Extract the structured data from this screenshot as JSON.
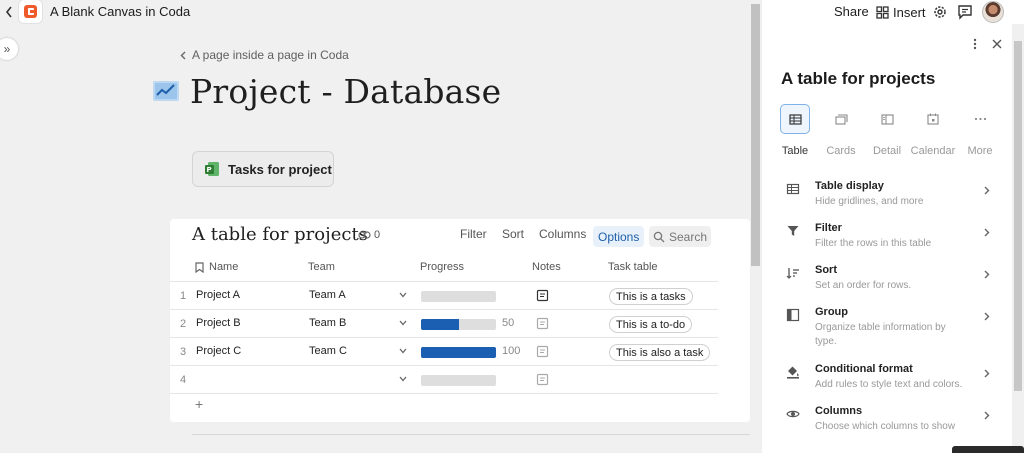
{
  "topbar": {
    "doc_title": "A Blank Canvas in Coda",
    "share_label": "Share",
    "insert_label": "Insert"
  },
  "page": {
    "breadcrumb": "A page inside a page in Coda",
    "title": "Project - Database",
    "button_label": "Tasks for project"
  },
  "table": {
    "title": "A table for projects",
    "link_count": "0",
    "toolbar": {
      "filter": "Filter",
      "sort": "Sort",
      "columns": "Columns",
      "options": "Options",
      "search": "Search"
    },
    "columns": [
      "Name",
      "Team",
      "Progress",
      "Notes",
      "Task table"
    ],
    "rows": [
      {
        "num": "1",
        "name": "Project A",
        "team": "Team A",
        "progress": 0,
        "progress_label": "",
        "task": "This is a tasks"
      },
      {
        "num": "2",
        "name": "Project B",
        "team": "Team B",
        "progress": 0.5,
        "progress_label": "50",
        "task": "This is a to-do"
      },
      {
        "num": "3",
        "name": "Project C",
        "team": "Team C",
        "progress": 1.0,
        "progress_label": "100",
        "task": "This is also a task"
      },
      {
        "num": "4",
        "name": "",
        "team": "",
        "progress": 0,
        "progress_label": "",
        "task": ""
      }
    ],
    "add_row": "+",
    "accent_color": "#1a5fb1"
  },
  "panel": {
    "title": "A table for projects",
    "layouts": [
      {
        "label": "Table",
        "icon": "table-icon",
        "active": true
      },
      {
        "label": "Cards",
        "icon": "cards-icon",
        "active": false
      },
      {
        "label": "Detail",
        "icon": "detail-icon",
        "active": false
      },
      {
        "label": "Calendar",
        "icon": "calendar-icon",
        "active": false
      },
      {
        "label": "More",
        "icon": "more-icon",
        "active": false
      }
    ],
    "options": [
      {
        "title": "Table display",
        "desc": "Hide gridlines, and more",
        "icon": "table-display-icon"
      },
      {
        "title": "Filter",
        "desc": "Filter the rows in this table",
        "icon": "filter-icon"
      },
      {
        "title": "Sort",
        "desc": "Set an order for rows.",
        "icon": "sort-icon"
      },
      {
        "title": "Group",
        "desc": "Organize table information by type.",
        "icon": "group-icon"
      },
      {
        "title": "Conditional format",
        "desc": "Add rules to style text and colors.",
        "icon": "paint-bucket-icon"
      },
      {
        "title": "Columns",
        "desc": "Choose which columns to show",
        "icon": "eye-icon"
      }
    ]
  }
}
